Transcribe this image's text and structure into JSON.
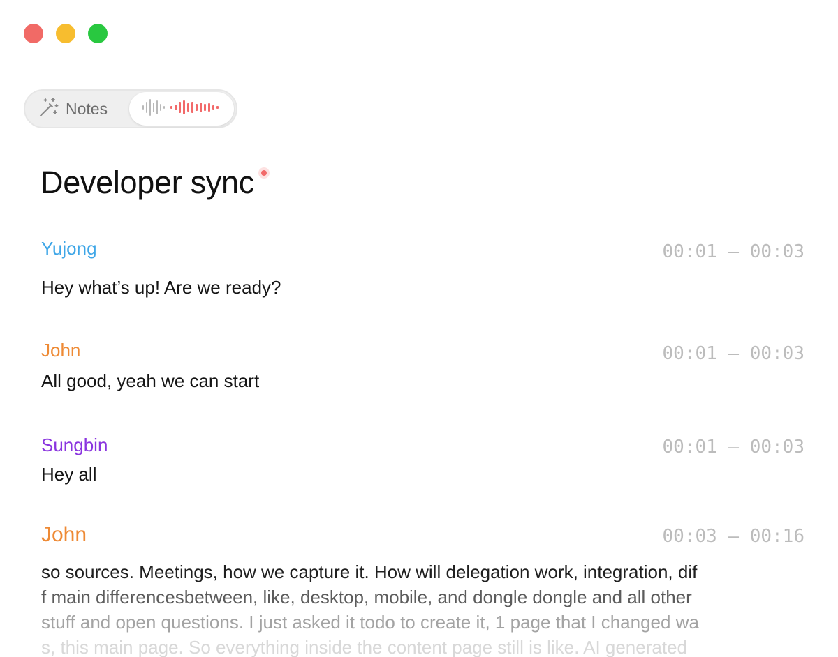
{
  "window": {
    "traffic_lights": {
      "close": "#f16a66",
      "minimize": "#f7bd2f",
      "zoom": "#29c840"
    }
  },
  "mode_toggle": {
    "notes_label": "Notes",
    "notes_icon": "magic-wand-icon",
    "recording_icon": "waveform-icon",
    "active": "recording",
    "recording_color": "#f26a6a"
  },
  "page": {
    "title": "Developer sync",
    "recording_indicator_color": "#f26a6a"
  },
  "transcript": [
    {
      "speaker": "Yujong",
      "color": "#3ea6e7",
      "time": "00:01 — 00:03",
      "text": "Hey what’s up! Are we ready?"
    },
    {
      "speaker": "John",
      "color": "#ee8a35",
      "time": "00:01 — 00:03",
      "text": "All good, yeah we can start"
    },
    {
      "speaker": "Sungbin",
      "color": "#8a35df",
      "time": "00:01 — 00:03",
      "text": "Hey all"
    },
    {
      "speaker": "John",
      "color": "#ee8a35",
      "time": "00:03 — 00:16",
      "lines": [
        "so sources. Meetings, how we capture it. How will delegation work, integration, dif",
        "f main differencesbetween, like, desktop, mobile, and dongle dongle and all other",
        "stuff and open questions. I just asked it todo to create it, 1 page that I changed wa",
        "s, this main page. So everything inside the content page still is like. AI generated"
      ]
    }
  ]
}
